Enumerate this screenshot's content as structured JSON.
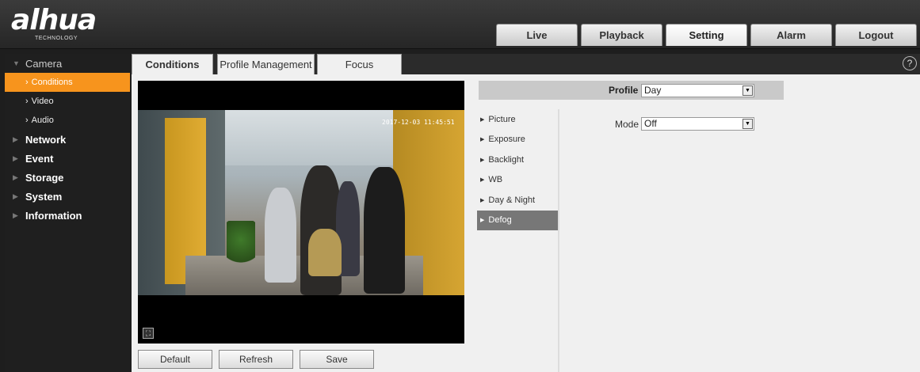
{
  "brand": {
    "logo_text": "alhua",
    "logo_sub": "TECHNOLOGY"
  },
  "nav": [
    {
      "label": "Live"
    },
    {
      "label": "Playback"
    },
    {
      "label": "Setting",
      "active": true
    },
    {
      "label": "Alarm"
    },
    {
      "label": "Logout"
    }
  ],
  "sidebar": {
    "camera": "Camera",
    "camera_items": [
      {
        "label": "Conditions",
        "active": true
      },
      {
        "label": "Video"
      },
      {
        "label": "Audio"
      }
    ],
    "categories": [
      "Network",
      "Event",
      "Storage",
      "System",
      "Information"
    ]
  },
  "tabs": [
    {
      "label": "Conditions",
      "active": true
    },
    {
      "label": "Profile Management"
    },
    {
      "label": "Focus"
    }
  ],
  "help_icon": "?",
  "video": {
    "osd_time": "2017-12-03 11:45:51"
  },
  "buttons": {
    "default": "Default",
    "refresh": "Refresh",
    "save": "Save"
  },
  "profile": {
    "label": "Profile",
    "value": "Day"
  },
  "settings_menu": [
    {
      "label": "Picture"
    },
    {
      "label": "Exposure"
    },
    {
      "label": "Backlight"
    },
    {
      "label": "WB"
    },
    {
      "label": "Day & Night"
    },
    {
      "label": "Defog",
      "active": true
    }
  ],
  "mode": {
    "label": "Mode",
    "value": "Off"
  },
  "colors": {
    "accent": "#f7941d",
    "header": "#2e2e2e",
    "active_menu": "#777777"
  }
}
